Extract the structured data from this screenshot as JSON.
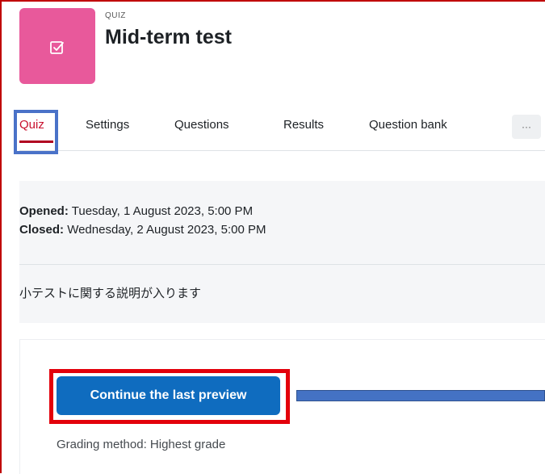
{
  "header": {
    "kicker": "QUIZ",
    "title": "Mid-term test",
    "icon": "quiz-checkbox-icon",
    "icon_color": "#e8599b"
  },
  "tabs": [
    {
      "label": "Quiz",
      "active": true
    },
    {
      "label": "Settings"
    },
    {
      "label": "Questions"
    },
    {
      "label": "Results"
    },
    {
      "label": "Question bank"
    }
  ],
  "more_label": "···",
  "info": {
    "opened_label": "Opened:",
    "opened_value": "Tuesday, 1 August 2023, 5:00 PM",
    "closed_label": "Closed:",
    "closed_value": "Wednesday, 2 August 2023, 5:00 PM",
    "description": "小テストに関する説明が入ります"
  },
  "action": {
    "button_label": "Continue the last preview",
    "button_color": "#0f6cbf",
    "grading_method": "Grading method: Highest grade"
  },
  "annotations": {
    "tab_highlight_color": "#4a72c8",
    "button_highlight_color": "#e3000b",
    "arrow_color": "#4472c4"
  }
}
